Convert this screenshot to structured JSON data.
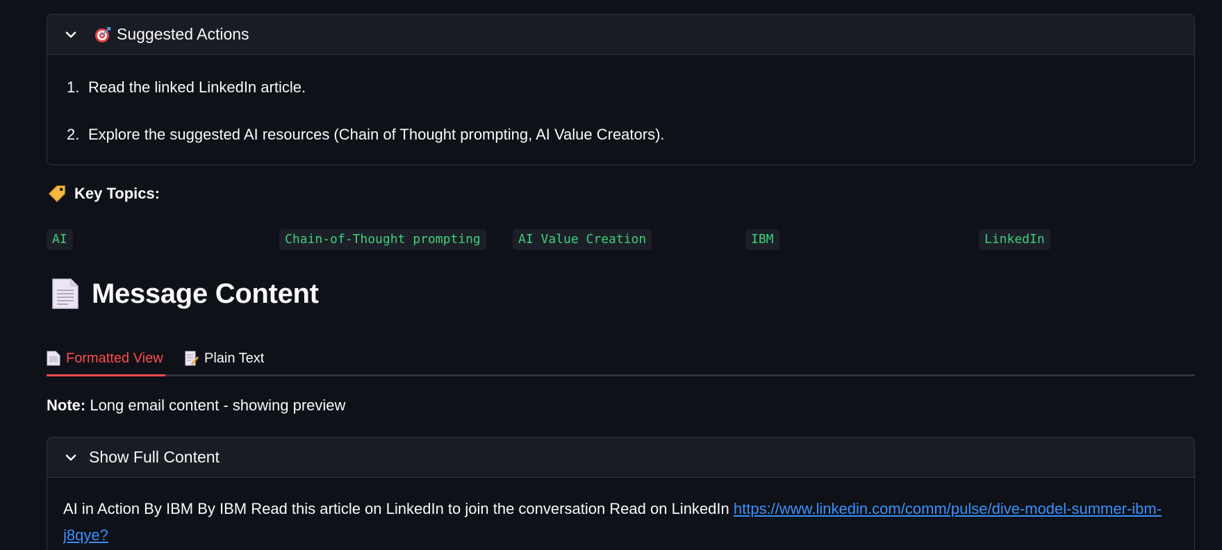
{
  "suggested_actions": {
    "title": "Suggested Actions",
    "emoji": "🎯",
    "items": [
      {
        "num": "1.",
        "text": "Read the linked LinkedIn article."
      },
      {
        "num": "2.",
        "text": "Explore the suggested AI resources (Chain of Thought prompting, AI Value Creators)."
      }
    ]
  },
  "key_topics": {
    "label": "Key Topics:",
    "topics": [
      "AI",
      "Chain-of-Thought prompting",
      "AI Value Creation",
      "IBM",
      "LinkedIn"
    ]
  },
  "message": {
    "title": "Message Content",
    "tabs": [
      {
        "label": "Formatted View",
        "active": true
      },
      {
        "label": "Plain Text",
        "active": false
      }
    ],
    "note_label": "Note:",
    "note_text": " Long email content - showing preview",
    "full_content": {
      "title": "Show Full Content",
      "text": "AI in Action By IBM By IBM Read this article on LinkedIn to join the conversation Read on LinkedIn ",
      "link": "https://www.linkedin.com/comm/pulse/dive-model-summer-ibm-j8qye?"
    }
  },
  "colors": {
    "background": "#0e1117",
    "accent": "#ff4b4b",
    "chip_text": "#3fd07b",
    "link": "#3a91ff"
  }
}
